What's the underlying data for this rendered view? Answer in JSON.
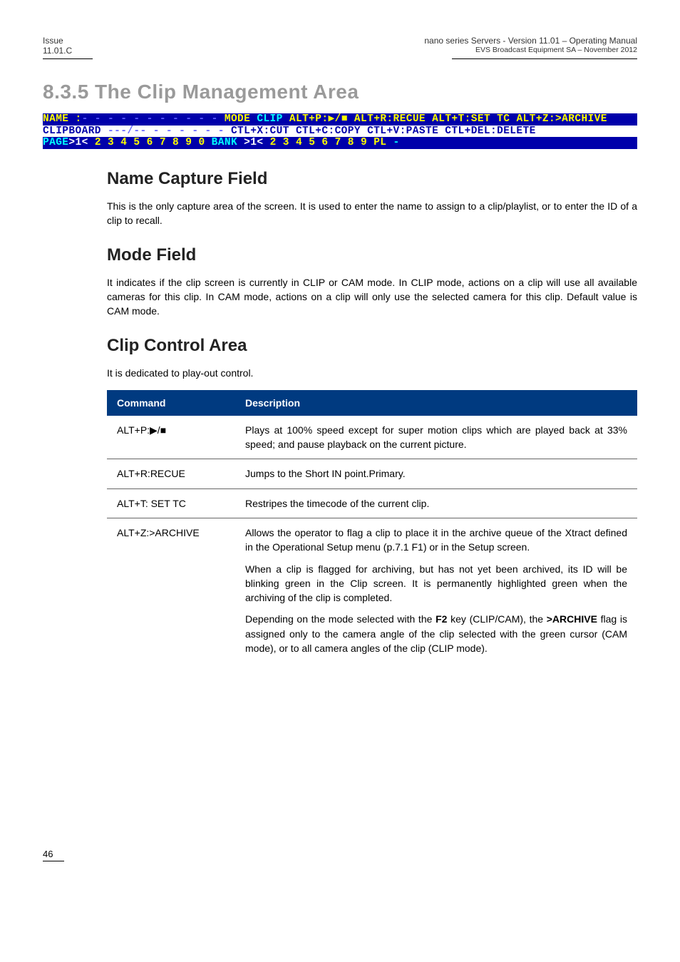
{
  "header": {
    "left_line1": "Issue",
    "left_line2": "11.01.C",
    "right_line1": "nano series Servers - Version 11.01 – Operating Manual",
    "right_line2": "EVS Broadcast Equipment SA – November 2012"
  },
  "section": {
    "number_title": "8.3.5  The  Clip  Management  Area"
  },
  "terminal": {
    "r1_name": "NAME :",
    "r1_dots": "- - - - - - - - - - -",
    "r1_mode": " MODE ",
    "r1_clip": "CLIP",
    "r1_cmds": "  ALT+P:▶/■ ALT+R:RECUE ALT+T:SET TC ALT+Z:>ARCHIVE ",
    "r2_clip": "CLIPBOARD ",
    "r2_dashes": "---/-- - - - - - -",
    "r2_cmds": "  CTL+X:CUT  CTL+C:COPY  CTL+V:PASTE  CTL+DEL:DELETE",
    "r3_page": "PAGE",
    "r3_pagesel": ">1<",
    "r3_pagenums": " 2  3  4  5  6  7  8  9  0   ",
    "r3_bank": "BANK ",
    "r3_banksel": ">1<",
    "r3_banknums": " 2  3  4  5  6  7  8  9  PL      ",
    "r3_end": "-"
  },
  "sub1": {
    "title": "Name  Capture  Field",
    "para": "This is the only capture area of the screen. It is used to enter the name to assign to a clip/playlist, or to enter the ID of a clip to recall."
  },
  "sub2": {
    "title": "Mode  Field",
    "para": "It indicates if the clip screen is currently in CLIP or CAM mode. In CLIP mode, actions on a clip will use all available cameras for this clip. In CAM mode, actions on a clip will only use the selected camera for this clip. Default value is CAM mode."
  },
  "sub3": {
    "title": "Clip  Control  Area",
    "intro": "It is dedicated to play-out control."
  },
  "table": {
    "head_cmd": "Command",
    "head_desc": "Description",
    "rows": [
      {
        "cmd": "ALT+P:▶/■",
        "desc": [
          "Plays at 100% speed except for super motion clips which are played back at 33% speed; and pause playback on the current picture."
        ]
      },
      {
        "cmd": "ALT+R:RECUE",
        "desc": [
          "Jumps to the Short IN point.Primary."
        ]
      },
      {
        "cmd": "ALT+T: SET TC",
        "desc": [
          "Restripes the timecode of the current clip."
        ]
      },
      {
        "cmd": "ALT+Z:>ARCHIVE",
        "desc": [
          "Allows the operator to flag a clip to place it in the archive queue of the Xtract defined in the Operational Setup menu (p.7.1 F1) or in the Setup screen.",
          "When a clip is flagged for archiving, but has not yet been archived, its ID will be blinking green in the Clip screen. It is permanently highlighted green when the archiving of the clip is completed.",
          "__bold__Depending on the mode selected with the <b>F2</b> key (CLIP/CAM), the <b>&gt;ARCHIVE</b> flag is assigned only to the camera angle of the clip selected with the green cursor (CAM mode), or to all camera angles of the clip (CLIP mode)."
        ]
      }
    ]
  },
  "footer": {
    "page": "46"
  }
}
